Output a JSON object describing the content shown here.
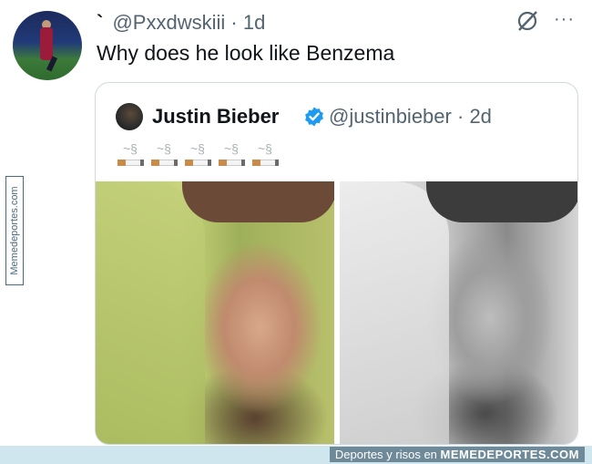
{
  "tweet": {
    "prefix": "`",
    "handle": "@Pxxdwskiii",
    "separator": "·",
    "time": "1d",
    "text": "Why does he look like Benzema",
    "more_label": "···"
  },
  "quote": {
    "name": "Justin Bieber",
    "handle": "@justinbieber",
    "separator": "·",
    "time": "2d",
    "emoji_count": 5,
    "emojis": [
      "🚬",
      "🚬",
      "🚬",
      "🚬",
      "🚬"
    ]
  },
  "watermark": {
    "side_label": "Memedeportes.com",
    "footer_text": "Deportes y risos en",
    "footer_brand": "MEMEDEPORTES.COM"
  },
  "colors": {
    "text_primary": "#0f1419",
    "text_secondary": "#536471",
    "verified_blue": "#1d9bf0",
    "border": "#cfd9de"
  },
  "icons": {
    "grok": "grok-icon",
    "more": "more-icon",
    "verified": "verified-badge-icon"
  }
}
